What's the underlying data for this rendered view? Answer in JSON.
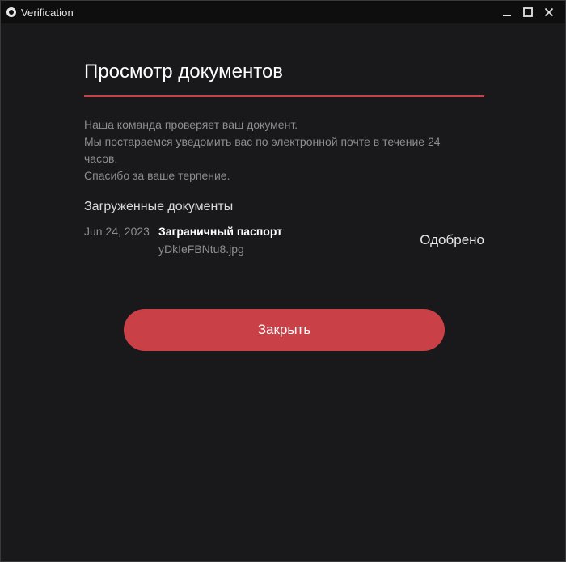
{
  "window": {
    "title": "Verification",
    "icons": {
      "app": "app-icon",
      "minimize": "minimize-icon",
      "maximize": "maximize-icon",
      "close": "close-icon"
    }
  },
  "page": {
    "title": "Просмотр документов",
    "message_lines": [
      "Наша команда проверяет ваш документ.",
      "Мы постараемся уведомить вас по электронной почте в течение 24",
      "часов.",
      "Спасибо за ваше терпение."
    ],
    "uploaded_section_title": "Загруженные документы",
    "documents": [
      {
        "date": "Jun 24, 2023",
        "name": "Заграничный паспорт",
        "file": "yDkIeFBNtu8.jpg",
        "status": "Одобрено"
      }
    ],
    "close_button_label": "Закрыть"
  },
  "colors": {
    "accent": "#c94147",
    "background": "#19181b",
    "titlebar": "#0e0e0f",
    "muted_text": "#8d8d92"
  }
}
